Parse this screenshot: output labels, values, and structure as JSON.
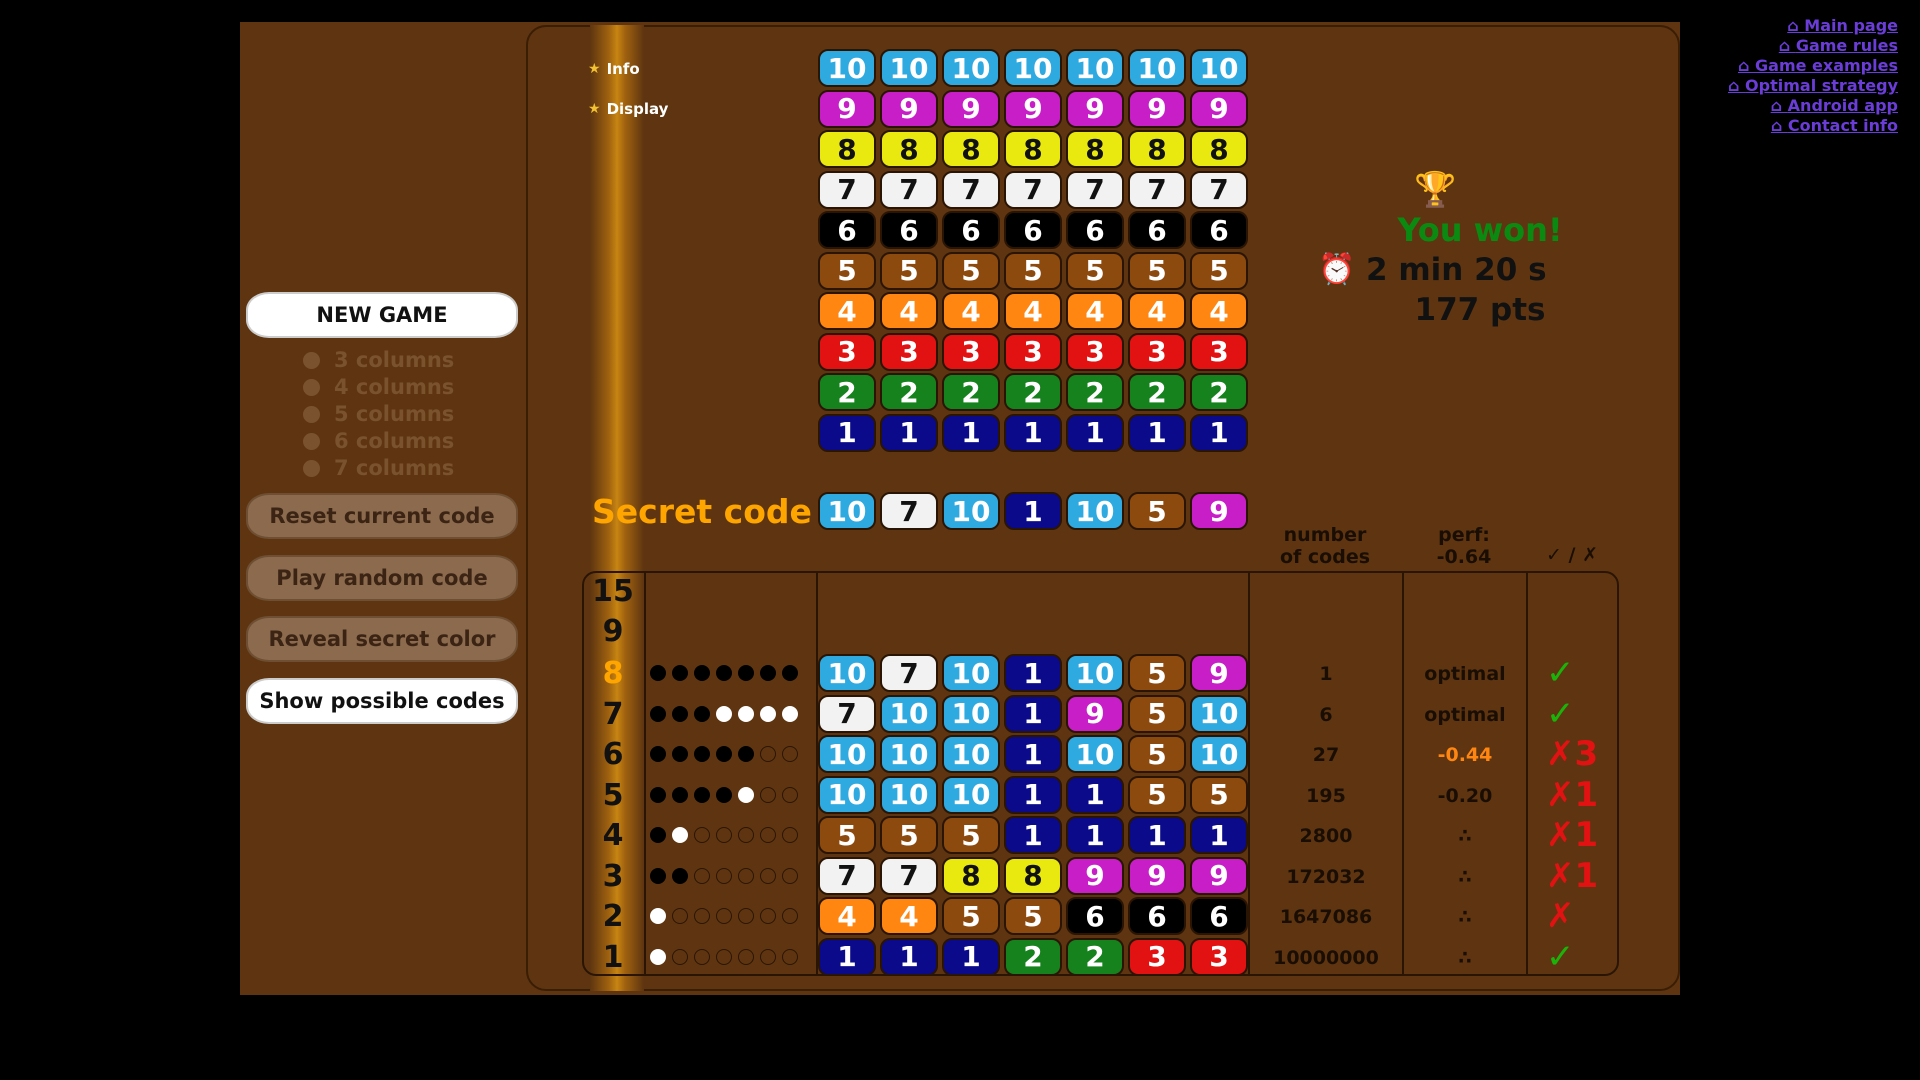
{
  "top_links": [
    "Main page",
    "Game rules",
    "Game examples",
    "Optimal strategy",
    "Android app",
    "Contact info"
  ],
  "menu": [
    "Info",
    "Display"
  ],
  "buttons": {
    "new_game": "NEW GAME",
    "reset": "Reset current code",
    "random": "Play random code",
    "reveal": "Reveal secret color",
    "show": "Show possible codes"
  },
  "column_options": [
    "3 columns",
    "4 columns",
    "5 columns",
    "6 columns",
    "7 columns"
  ],
  "palette_values": [
    "10",
    "9",
    "8",
    "7",
    "6",
    "5",
    "4",
    "3",
    "2",
    "1"
  ],
  "status": {
    "won": "You won!",
    "time": "2 min 20 s",
    "points": "177 pts"
  },
  "secret": {
    "label": "Secret code",
    "values": [
      "10",
      "7",
      "10",
      "1",
      "10",
      "5",
      "9"
    ]
  },
  "headers": {
    "number_of_codes": "number\nof codes",
    "perf": "perf:\n-0.64",
    "check": "✓ / ✗"
  },
  "empty_rows": [
    "15",
    "9"
  ],
  "rows": [
    {
      "n": "8",
      "feedback": "bbbbbbb",
      "code": [
        "10",
        "7",
        "10",
        "1",
        "10",
        "5",
        "9"
      ],
      "codes": "1",
      "perf": "optimal",
      "perf_color": "#1a0e04",
      "mark": "✓",
      "mark_ok": true
    },
    {
      "n": "7",
      "feedback": "bbbwwww",
      "code": [
        "7",
        "10",
        "10",
        "1",
        "9",
        "5",
        "10"
      ],
      "codes": "6",
      "perf": "optimal",
      "perf_color": "#1a0e04",
      "mark": "✓",
      "mark_ok": true
    },
    {
      "n": "6",
      "feedback": "bbbbbee",
      "code": [
        "10",
        "10",
        "10",
        "1",
        "10",
        "5",
        "10"
      ],
      "codes": "27",
      "perf": "-0.44",
      "perf_color": "#ff8610",
      "mark": "✗3",
      "mark_ok": false
    },
    {
      "n": "5",
      "feedback": "bbbbwee",
      "code": [
        "10",
        "10",
        "10",
        "1",
        "1",
        "5",
        "5"
      ],
      "codes": "195",
      "perf": "-0.20",
      "perf_color": "#1a0e04",
      "mark": "✗1",
      "mark_ok": false
    },
    {
      "n": "4",
      "feedback": "bweeeee",
      "code": [
        "5",
        "5",
        "5",
        "1",
        "1",
        "1",
        "1"
      ],
      "codes": "2800",
      "perf": "∴",
      "perf_color": "#1a0e04",
      "mark": "✗1",
      "mark_ok": false
    },
    {
      "n": "3",
      "feedback": "bbeeeee",
      "code": [
        "7",
        "7",
        "8",
        "8",
        "9",
        "9",
        "9"
      ],
      "codes": "172032",
      "perf": "∴",
      "perf_color": "#1a0e04",
      "mark": "✗1",
      "mark_ok": false
    },
    {
      "n": "2",
      "feedback": "weeeeee",
      "code": [
        "4",
        "4",
        "5",
        "5",
        "6",
        "6",
        "6"
      ],
      "codes": "1647086",
      "perf": "∴",
      "perf_color": "#1a0e04",
      "mark": "✗",
      "mark_ok": false
    },
    {
      "n": "1",
      "feedback": "weeeeee",
      "code": [
        "1",
        "1",
        "1",
        "2",
        "2",
        "3",
        "3"
      ],
      "codes": "10000000",
      "perf": "∴",
      "perf_color": "#1a0e04",
      "mark": "✓",
      "mark_ok": true
    }
  ],
  "colors": {
    "background": "#000000",
    "panel": "#5e3510",
    "accent_orange": "#ffa500",
    "won_green": "#0b8a12",
    "link": "#6a3dd8"
  }
}
